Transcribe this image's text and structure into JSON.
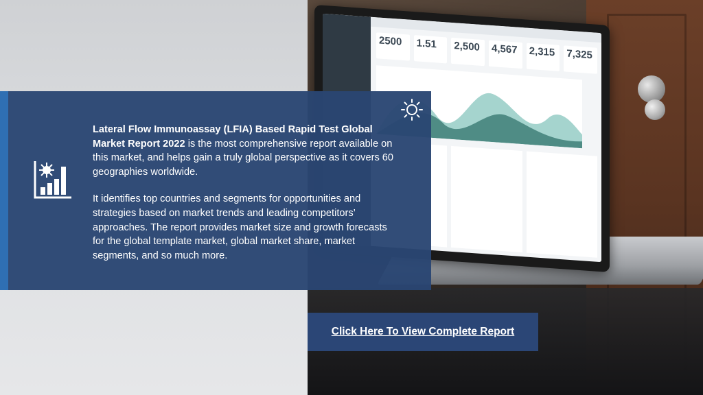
{
  "report": {
    "title_bold": "Lateral Flow Immunoassay (LFIA) Based Rapid Test Global Market Report 2022",
    "title_rest": " is the most comprehensive report available on this market, and helps gain a truly global perspective as it covers 60 geographies worldwide.",
    "paragraph_2": "It identifies top countries and segments for opportunities and strategies based on market trends and leading competitors’ approaches. The report provides market size and growth forecasts for the global template market, global market share, market segments, and so much more."
  },
  "cta": {
    "label": "Click Here To View Complete Report"
  },
  "screen_kpis": [
    "2500",
    "1.51",
    "2,500",
    "4,567",
    "2,315",
    "7,325"
  ],
  "icons": {
    "left": "chart-with-virus-icon",
    "top_right": "lightbulb-idea-icon"
  },
  "colors": {
    "panel": "#2a4673",
    "accent": "#2f6fb3",
    "cta": "#2b4676",
    "text": "#ffffff"
  }
}
